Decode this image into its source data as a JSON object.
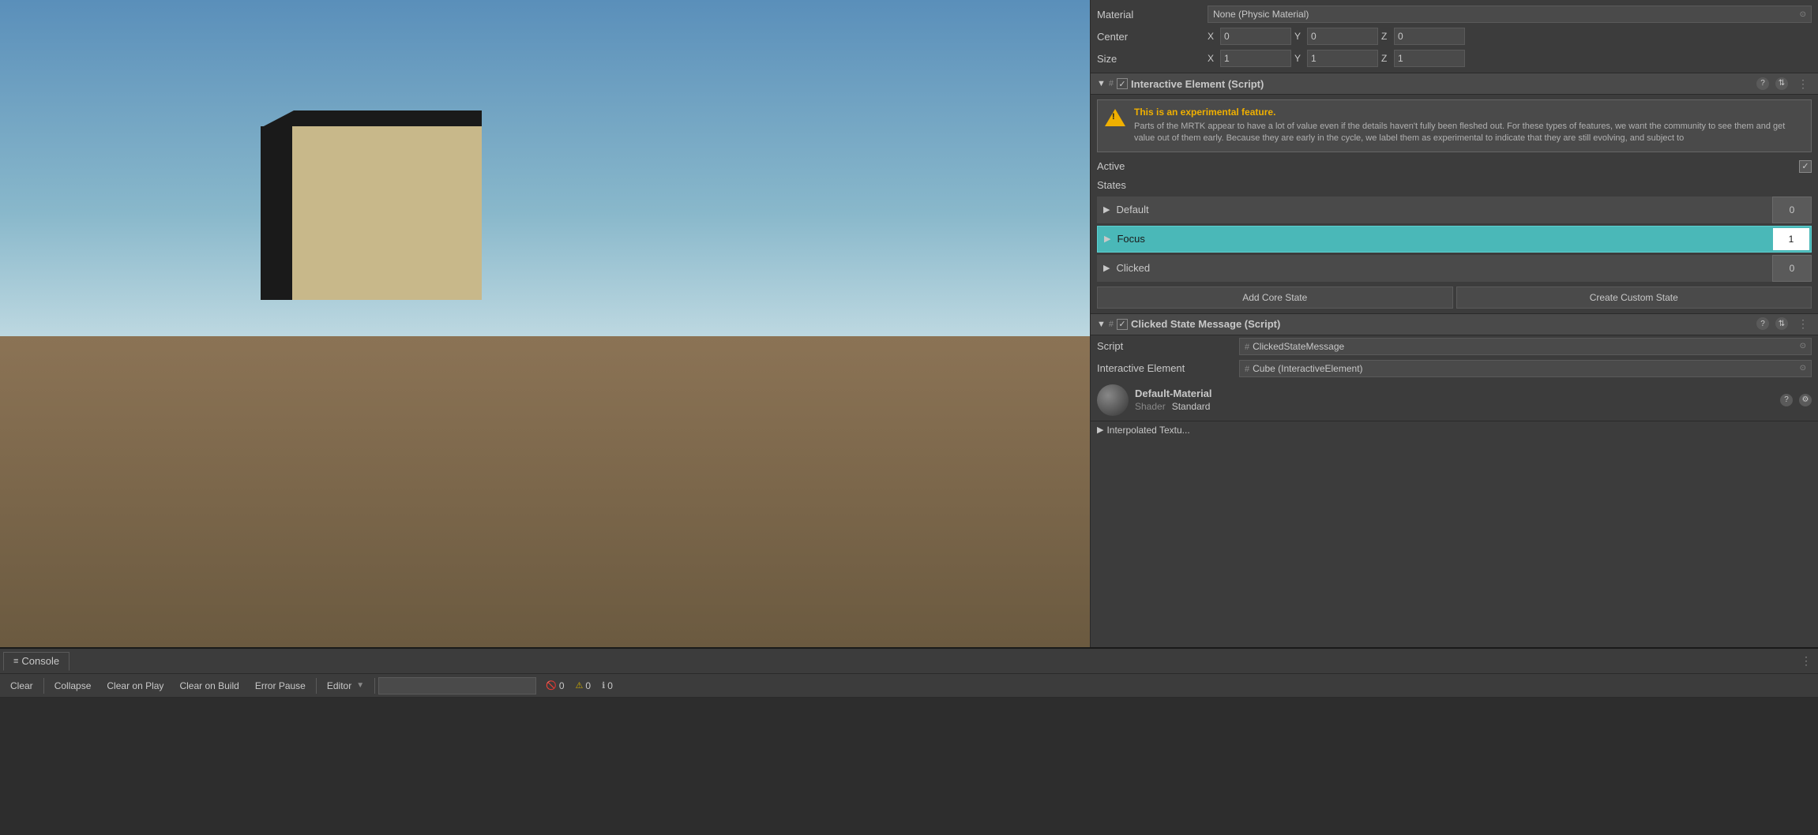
{
  "inspector": {
    "material_label": "Material",
    "material_value": "None (Physic Material)",
    "center_label": "Center",
    "center_x": "0",
    "center_y": "0",
    "center_z": "0",
    "size_label": "Size",
    "size_x": "1",
    "size_y": "1",
    "size_z": "1",
    "component1_title": "Interactive Element (Script)",
    "warning_title": "This is an experimental feature.",
    "warning_desc": "Parts of the MRTK appear to have a lot of value even if the details haven't fully been fleshed out. For these types of features, we want the community to see them and get value out of them early. Because they are early in the cycle, we label them as experimental to indicate that they are still evolving, and subject to",
    "active_label": "Active",
    "states_label": "States",
    "state_default": "Default",
    "state_default_value": "0",
    "state_focus": "Focus",
    "state_focus_value": "1",
    "state_clicked": "Clicked",
    "state_clicked_value": "0",
    "add_core_state": "Add Core State",
    "create_custom_state": "Create Custom State",
    "component2_title": "Clicked State Message (Script)",
    "script_label": "Script",
    "script_value": "ClickedStateMessage",
    "interactive_element_label": "Interactive Element",
    "interactive_element_value": "Cube (InteractiveElement)",
    "material_section_name": "Default-Material",
    "shader_label": "Shader",
    "shader_value": "Standard"
  },
  "console": {
    "tab_label": "Console",
    "tab_icon": "≡",
    "btn_clear": "Clear",
    "btn_collapse": "Collapse",
    "btn_clear_on_play": "Clear on Play",
    "btn_clear_on_build": "Clear on Build",
    "btn_error_pause": "Error Pause",
    "btn_editor": "Editor",
    "search_placeholder": "",
    "count_error": "0",
    "count_warn": "0",
    "count_info": "0",
    "menu_icon": "⋮"
  }
}
